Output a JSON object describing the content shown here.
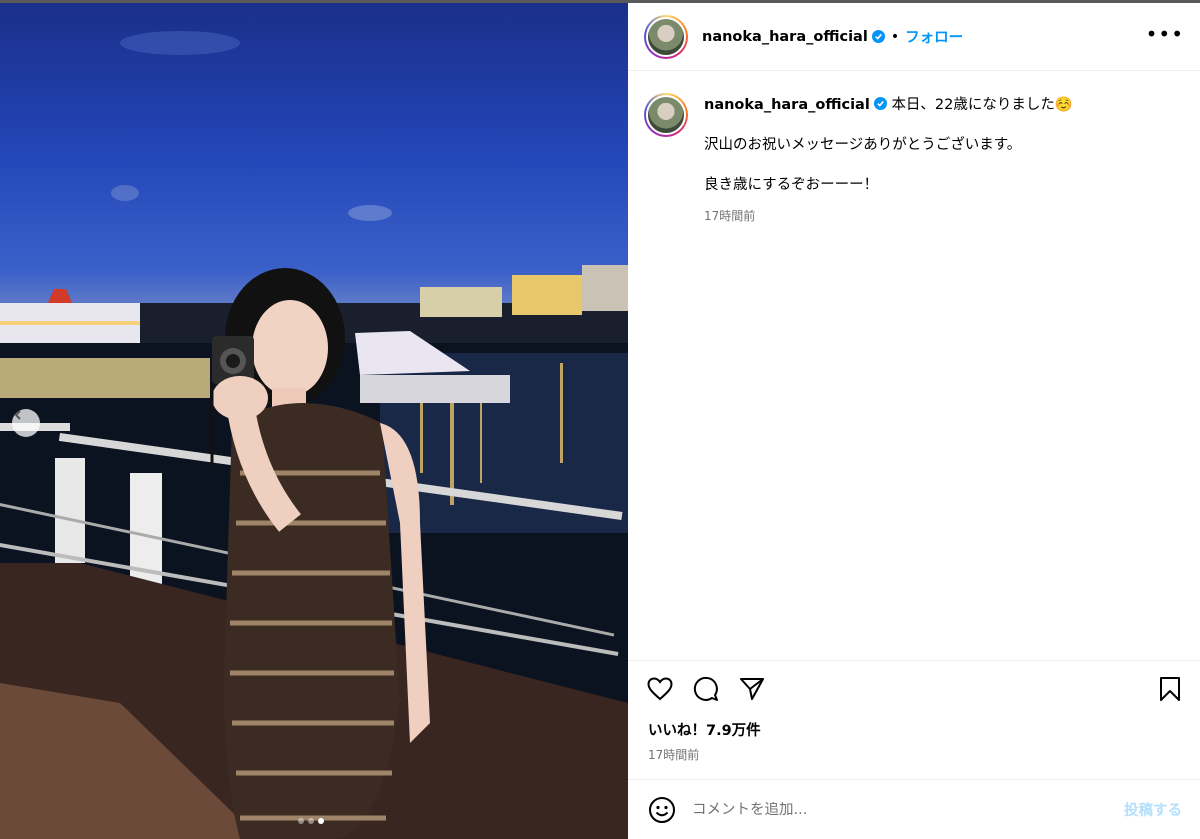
{
  "post": {
    "username": "nanoka_hara_official",
    "follow_label": "フォロー",
    "separator": "•",
    "more_label": "•••"
  },
  "caption": {
    "username": "nanoka_hara_official",
    "line1": "本日、22歳になりました☺️",
    "line2": "沢山のお祝いメッセージありがとうございます。",
    "line3": "良き歳にするぞおーーー！",
    "time": "17時間前"
  },
  "engagement": {
    "likes": "いいね！7.9万件",
    "time": "17時間前"
  },
  "comment": {
    "placeholder": "コメントを追加...",
    "post_label": "投稿する"
  },
  "carousel": {
    "total": 3,
    "active_index": 2
  },
  "colors": {
    "accent": "#0095f6",
    "post_disabled": "#b2dffc",
    "secondary_text": "#737373"
  }
}
